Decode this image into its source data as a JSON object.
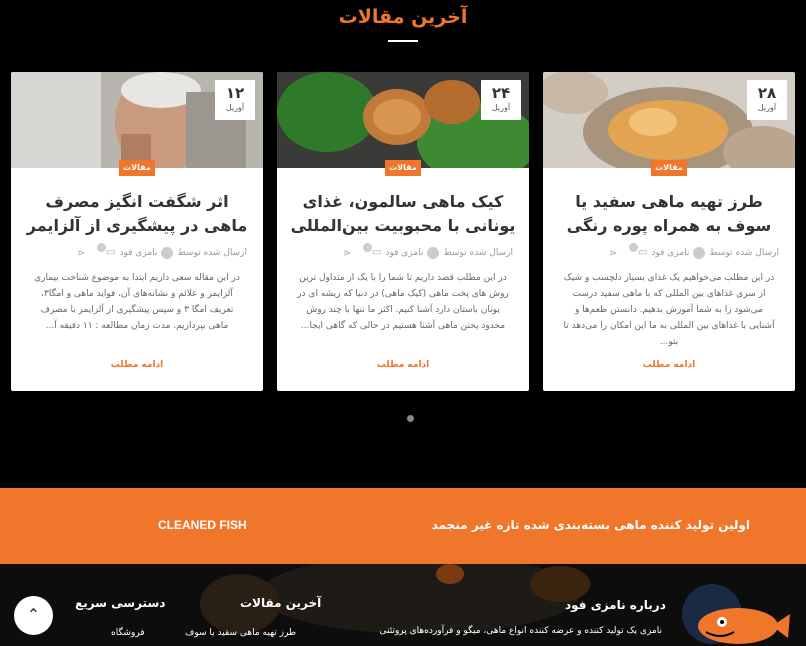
{
  "section": {
    "title": "آخرین مقالات"
  },
  "posts": [
    {
      "day": "۱۲",
      "month": "آوریل",
      "category": "مقالات",
      "title": "اثر شگفت انگیز مصرف ماهی در پیشگیری از آلزایمر",
      "posted_by": "ارسال شده توسط",
      "author": "نامزی فود",
      "comments": "۰",
      "excerpt": "در این مقاله سعی داریم ابتدا به موضوع شناخت بیماری آلزایمر و علائم و نشانه‌های آن، فواید ماهی و امگا۳، تعریف امگا ۳ و سپس پیشگیری از آلزایمر با مصرف ماهی بپردازیم. مدت زمان مطالعه : ۱۱ دقیقه آ...",
      "read_more": "ادامه مطلب"
    },
    {
      "day": "۲۴",
      "month": "آوریل",
      "category": "مقالات",
      "title": "کیک ماهی سالمون، غذای یونانی با محبوبیت بین‌المللی",
      "posted_by": "ارسال شده توسط",
      "author": "نامزی فود",
      "comments": "۰",
      "excerpt": "در این مطلب قصد داریم تا شما را با یک از متداول ترین روش های پخت ماهی (کیک ماهی) در دنیا که ریشه ای در یونان باستان دارد آشنا کنیم. اکثر ما تنها با چند روش محدود پختن ماهی آشنا هستیم در حالی که گاهی ایجا...",
      "read_more": "ادامه مطلب"
    },
    {
      "day": "۲۸",
      "month": "آوریل",
      "category": "مقالات",
      "title": "طرز تهیه ماهی سفید یا سوف به همراه پوره رنگی",
      "posted_by": "ارسال شده توسط",
      "author": "نامزی فود",
      "comments": "۰",
      "excerpt": "در این مطلب می‌خواهیم یک غذای بسیار دلچسب و شیک از سری غذاهای بین المللی که با ماهی سفید درست می‌شود را به شما آموزش بدهیم. دانستن طعم‌ها و آشنایی با غذاهای بین المللی به ما این امکان را می‌دهد تا بتو...",
      "read_more": "ادامه مطلب"
    }
  ],
  "banner": {
    "left_text": "CLEANED FISH",
    "right_text": "اولین تولید کننده ماهی بسته‌بندی شده تازه غیر منجمد"
  },
  "footer": {
    "about_title": "درباره نامزی فود",
    "about_text": "نامزی یک تولید کننده و عرضه کننده انواع ماهی، میگو و فرآورده‌های پروتئنی",
    "latest_title": "آخرین مقالات",
    "latest_item": "طرز تهیه ماهی سفید یا سوف",
    "quick_title": "دسترسی سریع",
    "quick_item": "فروشگاه"
  },
  "colors": {
    "accent": "#f0762b"
  }
}
